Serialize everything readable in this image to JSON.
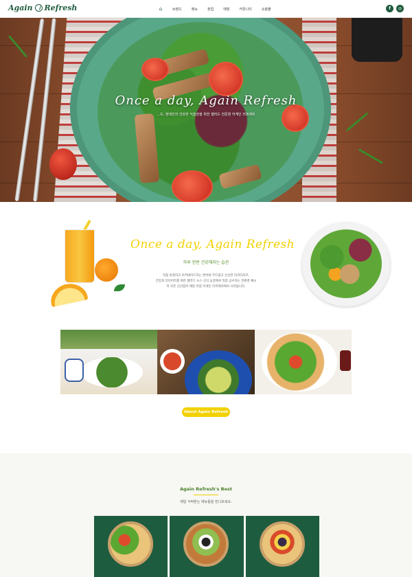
{
  "header": {
    "logo_left": "Again",
    "logo_right": "Refresh",
    "home_icon": "home-icon",
    "nav": [
      "브랜드",
      "메뉴",
      "창업",
      "매장",
      "커뮤니티",
      "쇼핑몰"
    ],
    "social": [
      {
        "icon": "facebook-icon",
        "glyph": "f"
      },
      {
        "icon": "instagram-icon",
        "glyph": "◎"
      }
    ]
  },
  "hero": {
    "script": "Once a day, Again Refresh",
    "subtitle": "...드, 현대인의 건강한 식습관을 위한 샐러드 전문점 어게인 리프레쉬"
  },
  "intro": {
    "script": "Once a day, Again Refresh",
    "subtitle": "하루 한번 건강해지는 습관",
    "desc": [
      "직접 손질하고 아끼네어드하는 연어와 부드럽고 신선한 리코타치즈,",
      "건강과 다이어트를 위한 샐러드 소스 선식 농장에서 직접 공수하는 친환경 채소",
      "이 모든 신선함이 매일 아침 어게인 리프레쉬에서 시작됩니다."
    ]
  },
  "about_button": "About Again Refresh",
  "best": {
    "title": "Again Refresh's Best",
    "subtitle": "매일 식탁받는 메뉴들을 만나보세요."
  },
  "colors": {
    "brand_green": "#1f5b3f",
    "accent_yellow": "#f2d100",
    "leaf_green": "#4a7f2c"
  }
}
